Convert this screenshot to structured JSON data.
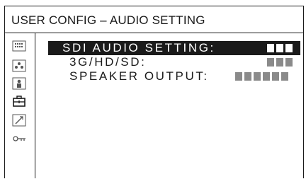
{
  "title": "USER CONFIG – AUDIO SETTING",
  "sidebar": {
    "icons": [
      "grid-icon",
      "people-icon",
      "person-icon",
      "toolbox-icon",
      "pen-icon",
      "key-icon"
    ],
    "active": "toolbox-icon"
  },
  "menu": {
    "items": [
      {
        "label": "SDI AUDIO SETTING:",
        "selected": true,
        "value_blocks": 3
      },
      {
        "label": "3G/HD/SD:",
        "selected": false,
        "value_blocks": 3
      },
      {
        "label": "SPEAKER OUTPUT:",
        "selected": false,
        "value_blocks": 6
      }
    ]
  }
}
